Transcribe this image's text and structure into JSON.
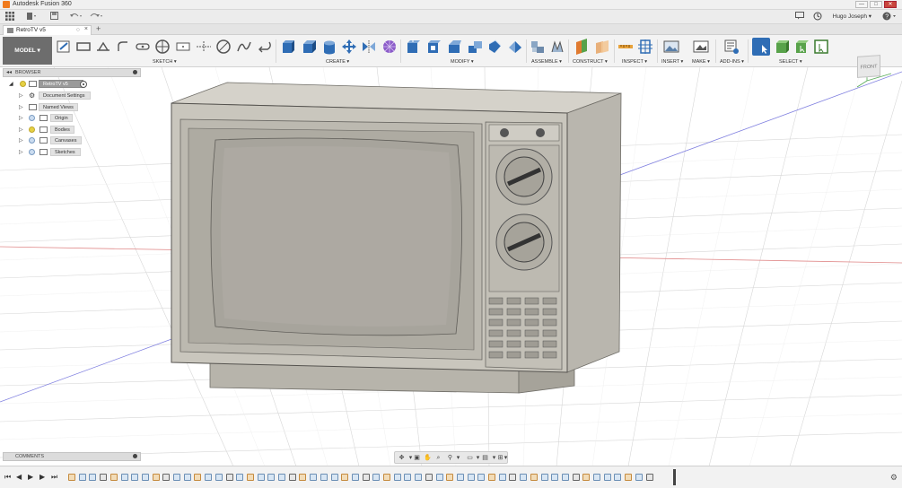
{
  "window": {
    "title": "Autodesk Fusion 360",
    "buttons": {
      "minimize": "—",
      "maximize": "□",
      "close": "✕"
    }
  },
  "quick_access": {
    "user_name": "Hugo Joseph ▾",
    "help": "?"
  },
  "document_tab": {
    "label": "RetroTV v5",
    "new_tab": "+"
  },
  "toolbar": {
    "workspace_label": "MODEL ▾",
    "groups": [
      {
        "label": "SKETCH ▾"
      },
      {
        "label": "CREATE ▾"
      },
      {
        "label": "MODIFY ▾"
      },
      {
        "label": "ASSEMBLE ▾"
      },
      {
        "label": "CONSTRUCT ▾"
      },
      {
        "label": "INSPECT ▾"
      },
      {
        "label": "INSERT ▾"
      },
      {
        "label": "MAKE ▾"
      },
      {
        "label": "ADD-INS ▾"
      },
      {
        "label": "SELECT ▾"
      }
    ]
  },
  "browser": {
    "header": "BROWSER",
    "items": [
      {
        "label": "RetroTV v5",
        "active": true
      },
      {
        "label": "Document Settings"
      },
      {
        "label": "Named Views"
      },
      {
        "label": "Origin"
      },
      {
        "label": "Bodies"
      },
      {
        "label": "Canvases"
      },
      {
        "label": "Sketches"
      }
    ]
  },
  "comments": {
    "header": "COMMENTS"
  },
  "viewcube": {
    "face": "FRONT"
  },
  "colors": {
    "model_body": "#c9c6bd",
    "model_dark": "#8f8c84",
    "axis_red": "#e07070",
    "axis_blue": "#6d6ddf",
    "toolbar_blue": "#2f6db5"
  }
}
